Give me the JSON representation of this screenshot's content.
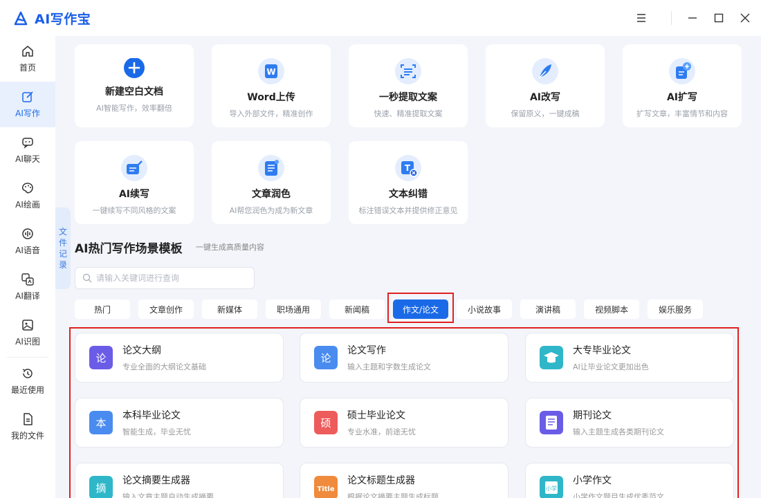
{
  "app": {
    "title": "AI写作宝"
  },
  "sidebar": {
    "items": [
      {
        "label": "首页",
        "icon": "home-icon"
      },
      {
        "label": "AI写作",
        "icon": "pen-edit-icon"
      },
      {
        "label": "AI聊天",
        "icon": "chat-icon"
      },
      {
        "label": "AI绘画",
        "icon": "palette-icon"
      },
      {
        "label": "AI语音",
        "icon": "voice-icon"
      },
      {
        "label": "AI翻译",
        "icon": "translate-icon"
      },
      {
        "label": "AI识图",
        "icon": "image-recognize-icon"
      },
      {
        "label": "最近使用",
        "icon": "history-icon"
      },
      {
        "label": "我的文件",
        "icon": "file-icon"
      }
    ],
    "active_index": 1
  },
  "records_tab": {
    "chars": [
      "文",
      "件",
      "记",
      "录"
    ]
  },
  "tools": [
    {
      "title": "新建空白文档",
      "desc": "AI智能写作，效率翻倍",
      "icon": "plus-circle-icon"
    },
    {
      "title": "Word上传",
      "desc": "导入外部文件，精准创作",
      "icon": "word-icon"
    },
    {
      "title": "一秒提取文案",
      "desc": "快速、精准提取文案",
      "icon": "scan-text-icon"
    },
    {
      "title": "AI改写",
      "desc": "保留原义，一键成稿",
      "icon": "feather-icon"
    },
    {
      "title": "AI扩写",
      "desc": "扩写文章，丰富情节和内容",
      "icon": "expand-doc-icon"
    },
    {
      "title": "AI续写",
      "desc": "一键续写不同风格的文案",
      "icon": "continue-write-icon"
    },
    {
      "title": "文章润色",
      "desc": "AI帮您润色为成为新文章",
      "icon": "polish-doc-icon"
    },
    {
      "title": "文本纠错",
      "desc": "标注错误文本并提供修正意见",
      "icon": "text-correct-icon"
    }
  ],
  "section": {
    "title": "AI热门写作场景模板",
    "subtitle": "一键生成高质量内容"
  },
  "search": {
    "placeholder": "请输入关键词进行查询",
    "value": ""
  },
  "categories": [
    "热门",
    "文章创作",
    "新媒体",
    "职场通用",
    "新闻稿",
    "作文/论文",
    "小说故事",
    "演讲稿",
    "视频脚本",
    "娱乐服务"
  ],
  "active_category": "作文/论文",
  "templates": [
    {
      "title": "论文大纲",
      "desc": "专业全面的大纲论文基础",
      "icon": "outline-icon",
      "color": "#6b5ce7"
    },
    {
      "title": "论文写作",
      "desc": "输入主题和字数生成论文",
      "icon": "paper-write-icon",
      "color": "#4a8bf0"
    },
    {
      "title": "大专毕业论文",
      "desc": "AI让毕业论文更加出色",
      "icon": "graduation-cap-icon",
      "color": "#2fb7c9"
    },
    {
      "title": "本科毕业论文",
      "desc": "智能生成，毕业无忧",
      "icon": "bachelor-icon",
      "color": "#4a8bf0"
    },
    {
      "title": "硕士毕业论文",
      "desc": "专业水准，前途无忧",
      "icon": "master-icon",
      "color": "#ee5b5b"
    },
    {
      "title": "期刊论文",
      "desc": "输入主题生成各类期刊论文",
      "icon": "journal-icon",
      "color": "#6b5ce7"
    },
    {
      "title": "论文摘要生成器",
      "desc": "输入文章主题自动生成摘要",
      "icon": "abstract-icon",
      "color": "#2fb7c9"
    },
    {
      "title": "论文标题生成器",
      "desc": "根据论文摘要主题生成标题",
      "icon": "title-icon",
      "color": "#f08a3c"
    },
    {
      "title": "小学作文",
      "desc": "小学作文题目生成优秀范文",
      "icon": "primary-essay-icon",
      "color": "#2fb7c9"
    }
  ],
  "colors": {
    "accent": "#1a6ae8",
    "highlight_border": "#e02020"
  }
}
